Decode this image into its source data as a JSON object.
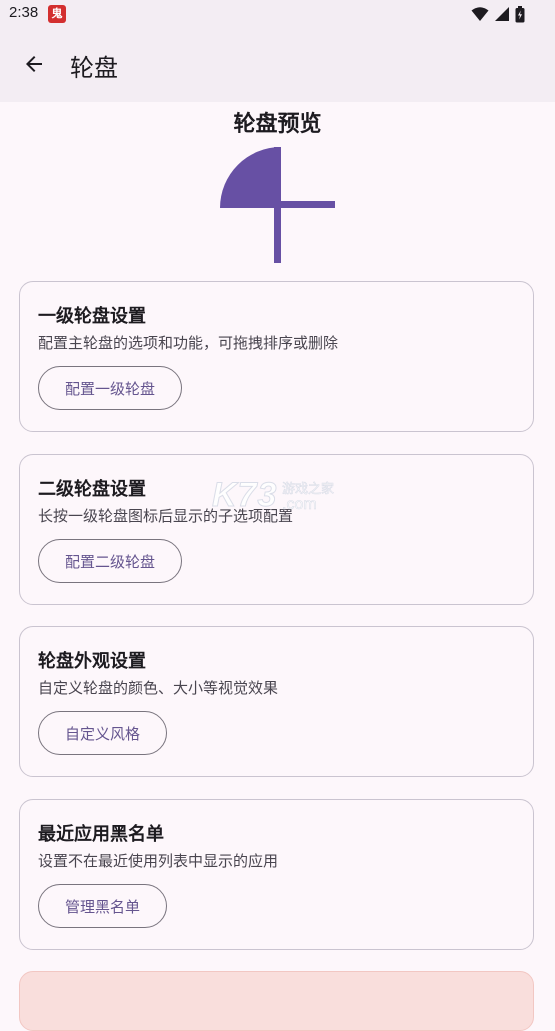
{
  "status_bar": {
    "time": "2:38",
    "app_icon_glyph": "鬼",
    "icons": [
      "wifi-icon",
      "signal-icon",
      "battery-icon"
    ]
  },
  "app_bar": {
    "title": "轮盘",
    "back_icon": "arrow-left-icon"
  },
  "preview": {
    "title": "轮盘预览",
    "accent_color": "#6750a4"
  },
  "cards": [
    {
      "title": "一级轮盘设置",
      "description": "配置主轮盘的选项和功能，可拖拽排序或删除",
      "button_label": "配置一级轮盘"
    },
    {
      "title": "二级轮盘设置",
      "description": "长按一级轮盘图标后显示的子选项配置",
      "button_label": "配置二级轮盘"
    },
    {
      "title": "轮盘外观设置",
      "description": "自定义轮盘的颜色、大小等视觉效果",
      "button_label": "自定义风格"
    },
    {
      "title": "最近应用黑名单",
      "description": "设置不在最近使用列表中显示的应用",
      "button_label": "管理黑名单"
    }
  ],
  "watermark": {
    "main": "K73",
    "sub": "游戏之家",
    "domain": ".com"
  },
  "colors": {
    "background": "#fdf7fb",
    "app_bar": "#f3edf3",
    "primary": "#65558f",
    "outline": "#cac4d0",
    "danger_container": "#f9dedc"
  }
}
